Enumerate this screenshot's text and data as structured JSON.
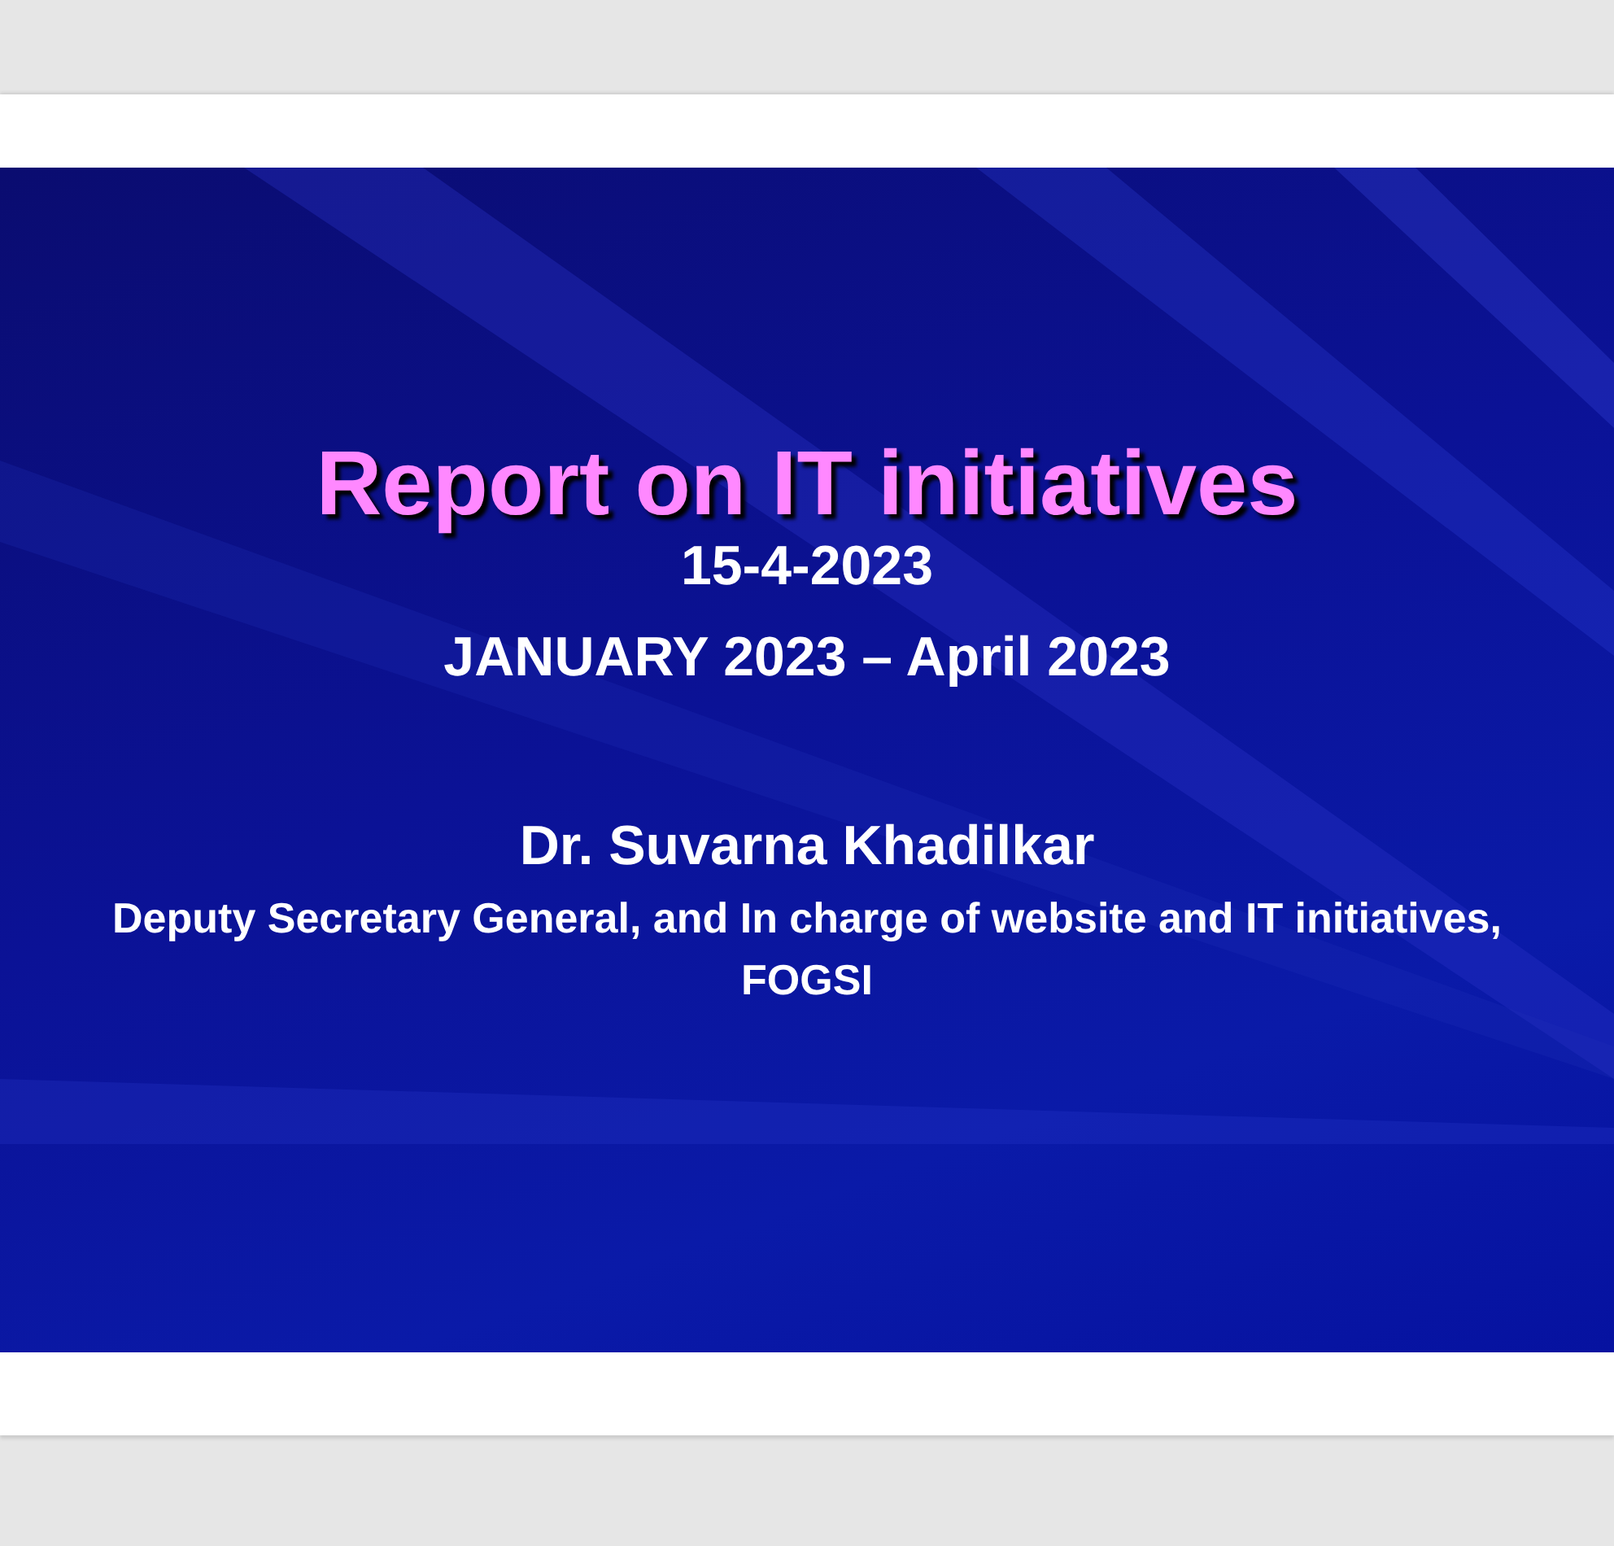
{
  "slide": {
    "title": "Report on IT initiatives",
    "date": "15-4-2023",
    "period": "JANUARY 2023 – April 2023",
    "presenter": "Dr. Suvarna Khadilkar",
    "role": "Deputy Secretary General, and In charge of website and IT initiatives, FOGSI"
  }
}
